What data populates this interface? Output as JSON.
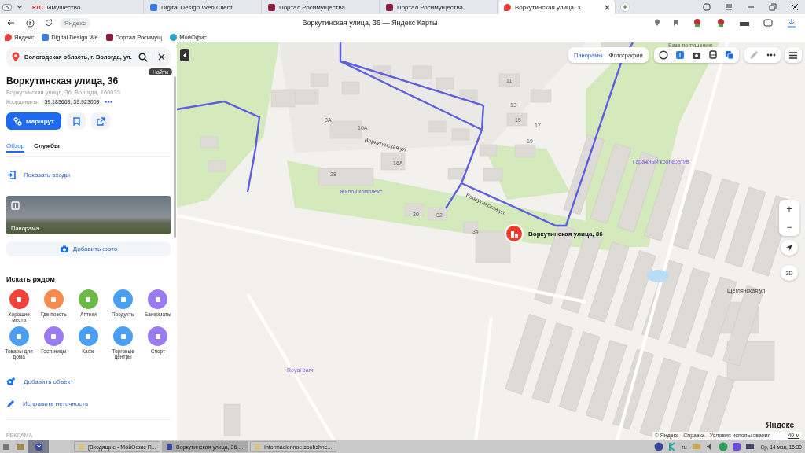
{
  "browser": {
    "tab_count": "5",
    "tabs": [
      {
        "title": "Имущество",
        "icon_text": "РТС",
        "kind": "text",
        "selected": false
      },
      {
        "title": "Digital Design Web Client",
        "kind": "doc",
        "selected": false
      },
      {
        "title": "Портал Росимущества",
        "kind": "portal",
        "selected": false
      },
      {
        "title": "Портал Росимущества",
        "kind": "portal",
        "selected": false
      },
      {
        "title": "Воркутинская улица, з",
        "kind": "pin",
        "selected": true
      }
    ],
    "omnibox": "Яндекс",
    "page_title": "Воркутинская улица, 36 — Яндекс Карты",
    "bookmarks": [
      {
        "title": "Яндекс",
        "kind": "pin"
      },
      {
        "title": "Digital Design We",
        "kind": "doc"
      },
      {
        "title": "Портал Росимущ",
        "kind": "portal"
      },
      {
        "title": "МойОфис",
        "kind": "office"
      }
    ]
  },
  "panel": {
    "search": {
      "value": "Вологодская область, г. Вологда, ул."
    },
    "tooltip": "Найти",
    "title": "Воркутинская улица, 36",
    "address": "Воркутинская улица, 36, Вологда, 160033",
    "coords_label": "Координаты:",
    "coords": "59.183663, 39.923009",
    "route_button": "Маршрут",
    "tabs": [
      {
        "label": "Обзор",
        "selected": true
      },
      {
        "label": "Службы",
        "selected": false
      }
    ],
    "entrances": "Показать входы",
    "panorama": "Панорама",
    "add_photo": "Добавить фото",
    "nearby_title": "Искать рядом",
    "categories": [
      {
        "label": "Хорошие места",
        "color": "#f0443a"
      },
      {
        "label": "Где поесть",
        "color": "#f68b4d"
      },
      {
        "label": "Аптеки",
        "color": "#6bb947"
      },
      {
        "label": "Продукты",
        "color": "#4b9ff2"
      },
      {
        "label": "Банкоматы",
        "color": "#9a7cf0"
      },
      {
        "label": "Товары для дома",
        "color": "#4b9ff2"
      },
      {
        "label": "Гостиницы",
        "color": "#9a7cf0"
      },
      {
        "label": "Кафе",
        "color": "#4b9ff2"
      },
      {
        "label": "Торговые центры",
        "color": "#4b9ff2"
      },
      {
        "label": "Спорт",
        "color": "#9a7cf0"
      }
    ],
    "add_object": "Добавить объект",
    "fix_error": "Исправить неточность",
    "ad_label": "РЕКЛАМА"
  },
  "map": {
    "layer_tabs": [
      "Панорамы",
      "Фотографии"
    ],
    "labels": [
      {
        "text": "База по тушению",
        "kind": "place"
      },
      {
        "text": "Воркутинская ул.",
        "kind": "street"
      },
      {
        "text": "Воркутинская ул.",
        "kind": "street"
      },
      {
        "text": "Жилой комплекс",
        "kind": "poi"
      },
      {
        "text": "Гаражный кооператив",
        "kind": "poi"
      },
      {
        "text": "Royal park",
        "kind": "poi"
      },
      {
        "text": "Щеглянская ул.",
        "kind": "street"
      },
      {
        "text": "Воркутинская улица, 36",
        "kind": "marker"
      },
      {
        "text": "8А",
        "kind": "house"
      },
      {
        "text": "10А",
        "kind": "house"
      },
      {
        "text": "16А",
        "kind": "house"
      },
      {
        "text": "30",
        "kind": "house"
      },
      {
        "text": "32",
        "kind": "house"
      },
      {
        "text": "34",
        "kind": "house"
      },
      {
        "text": "13",
        "kind": "house"
      },
      {
        "text": "15",
        "kind": "house"
      },
      {
        "text": "17",
        "kind": "house"
      },
      {
        "text": "19",
        "kind": "house"
      },
      {
        "text": "11",
        "kind": "house"
      },
      {
        "text": "28",
        "kind": "house"
      }
    ],
    "zoom_in": "+",
    "zoom_out": "−",
    "mode_3d": "3D",
    "logo": "Яндекс",
    "footer": [
      "© Яндекс",
      "Справка",
      "Условия использования"
    ],
    "scale": "40 м"
  },
  "taskbar": {
    "windows": [
      {
        "title": "[Входящие - МойОфис П...",
        "selected": false
      },
      {
        "title": "Воркутинская улица, 36 ...",
        "selected": true
      },
      {
        "title": "Informacionnoe soobshhe...",
        "selected": false
      }
    ],
    "lang": "ru",
    "clock": "Ср, 14 мая, 15:30"
  }
}
